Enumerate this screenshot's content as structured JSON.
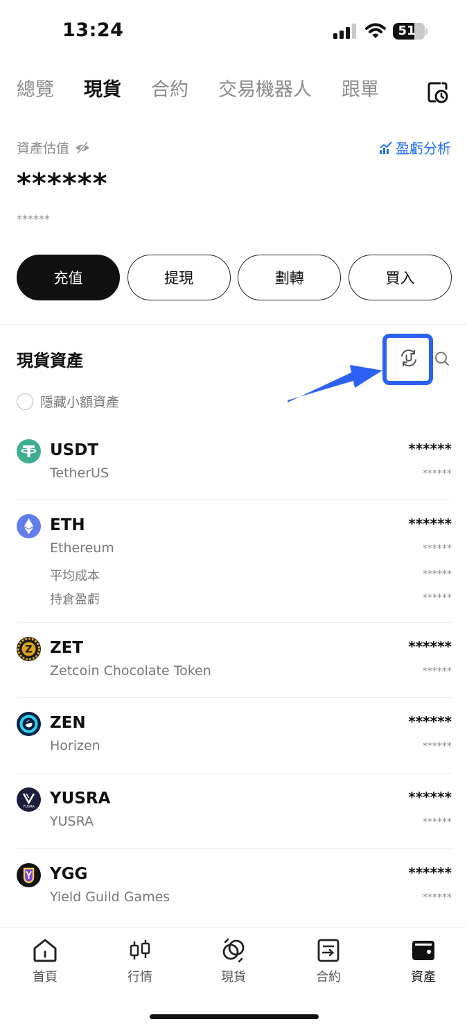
{
  "status_bar": {
    "time": "13:24",
    "battery": "51"
  },
  "top_tabs": [
    {
      "label": "總覽",
      "active": false
    },
    {
      "label": "現貨",
      "active": true
    },
    {
      "label": "合約",
      "active": false
    },
    {
      "label": "交易機器人",
      "active": false
    },
    {
      "label": "跟單",
      "active": false
    }
  ],
  "summary": {
    "label": "資產估值",
    "pnl_link": "盈虧分析",
    "value": "******",
    "sub_value": "******"
  },
  "actions": {
    "deposit": "充值",
    "withdraw": "提現",
    "transfer": "劃轉",
    "buy": "買入"
  },
  "spot": {
    "title": "現貨資產",
    "hide_small": "隱藏小額資產"
  },
  "assets": [
    {
      "symbol": "USDT",
      "name": "TetherUS",
      "amount": "******",
      "value": "******"
    },
    {
      "symbol": "ETH",
      "name": "Ethereum",
      "amount": "******",
      "value": "******",
      "extra": [
        {
          "label": "平均成本",
          "value": "******"
        },
        {
          "label": "持倉盈虧",
          "value": "******"
        }
      ]
    },
    {
      "symbol": "ZET",
      "name": "Zetcoin Chocolate Token",
      "amount": "******",
      "value": "******"
    },
    {
      "symbol": "ZEN",
      "name": "Horizen",
      "amount": "******",
      "value": "******"
    },
    {
      "symbol": "YUSRA",
      "name": "YUSRA",
      "amount": "******",
      "value": "******",
      "logo_text": "YUSRA"
    },
    {
      "symbol": "YGG",
      "name": "Yield Guild Games",
      "amount": "******",
      "value": "******"
    }
  ],
  "bottom_nav": [
    {
      "label": "首頁",
      "icon": "home-icon"
    },
    {
      "label": "行情",
      "icon": "candlestick-icon"
    },
    {
      "label": "現貨",
      "icon": "spot-icon"
    },
    {
      "label": "合約",
      "icon": "contract-icon"
    },
    {
      "label": "資產",
      "icon": "wallet-icon",
      "active": true
    }
  ],
  "colors": {
    "accent": "#1f6fff",
    "highlight": "#2b62f3",
    "usdt": "#3fad8f",
    "eth": "#627eea"
  }
}
